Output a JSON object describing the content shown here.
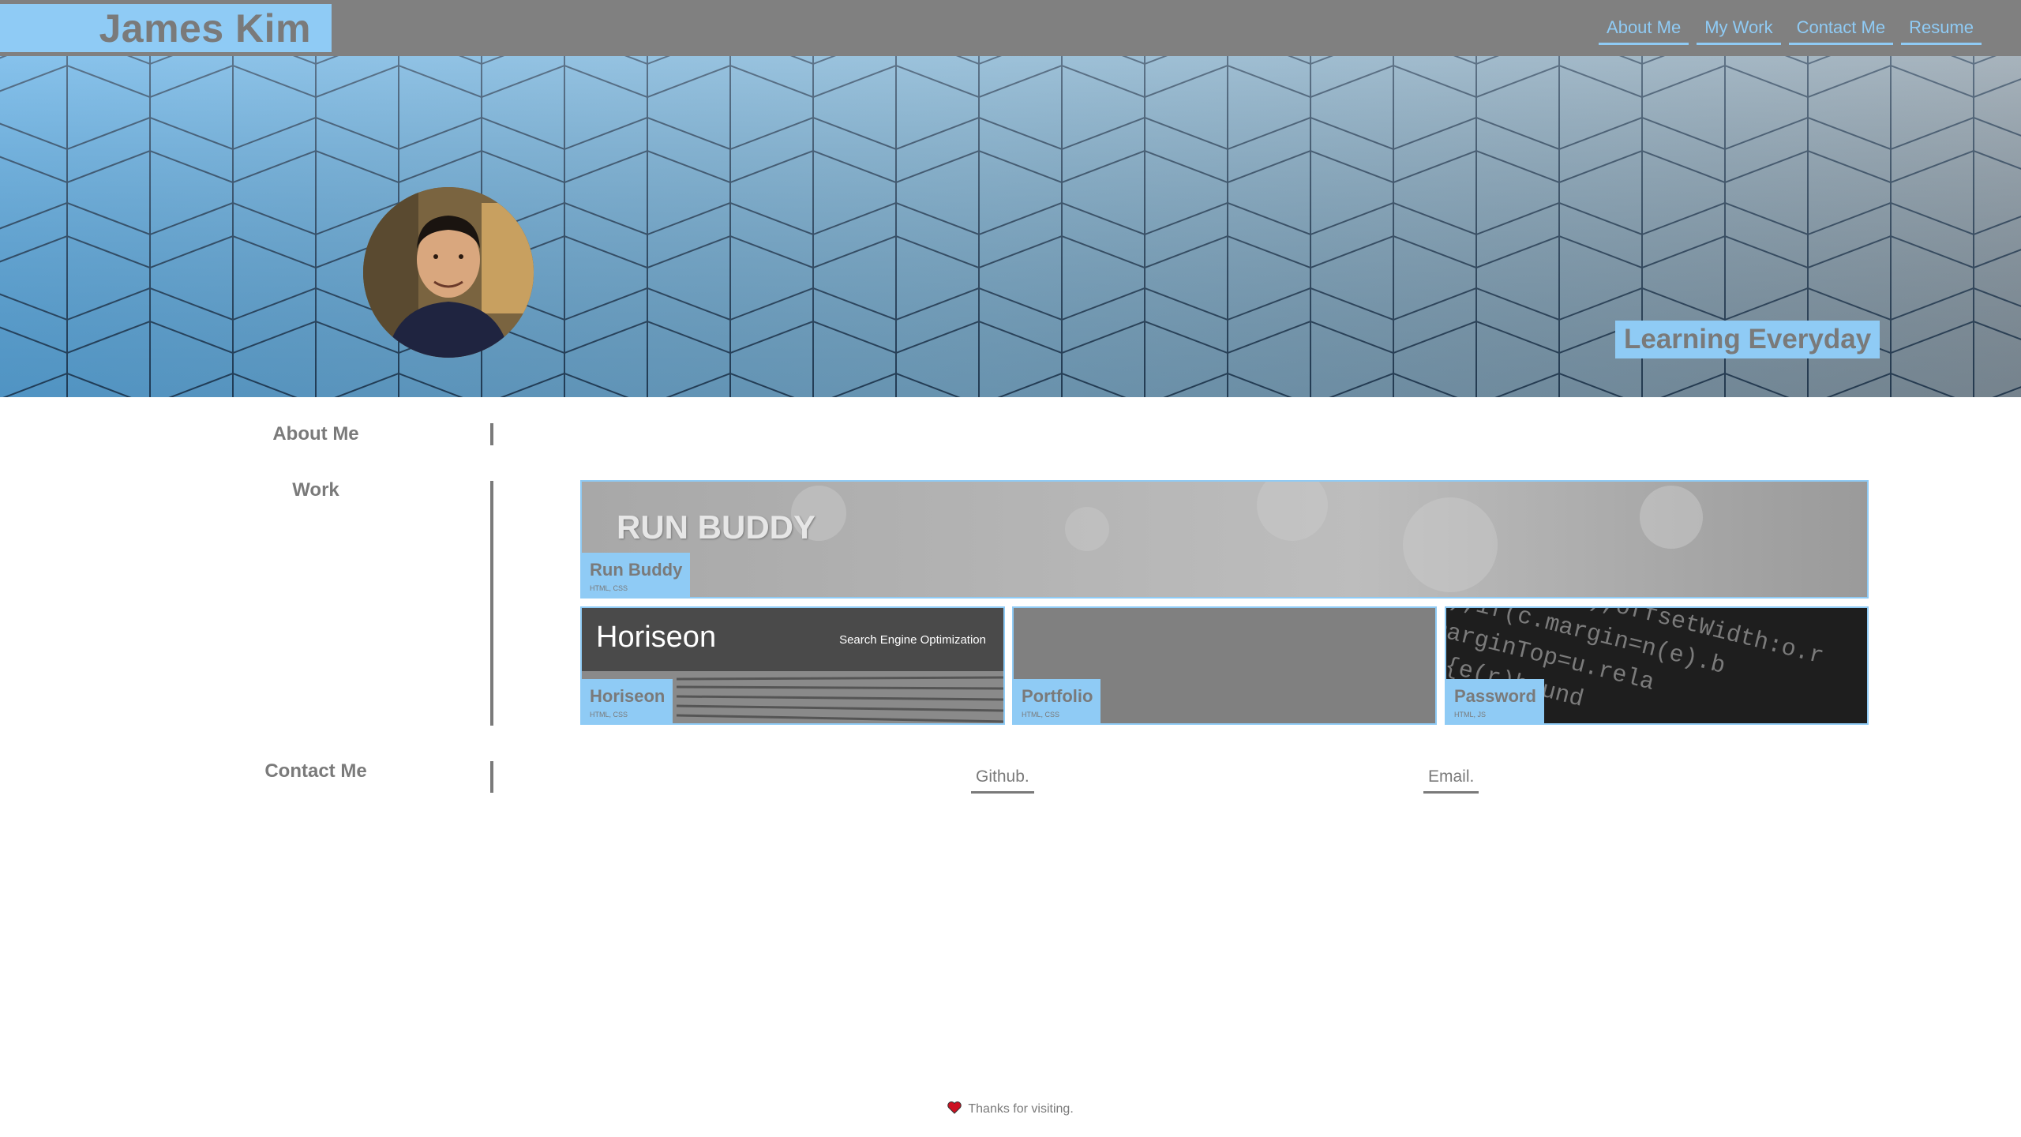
{
  "header": {
    "brand": "James Kim",
    "nav": [
      {
        "label": "About Me"
      },
      {
        "label": "My Work"
      },
      {
        "label": "Contact Me"
      },
      {
        "label": "Resume"
      }
    ]
  },
  "hero": {
    "tagline": "Learning Everyday",
    "avatar_icon": "profile-photo"
  },
  "sections": {
    "about": "About Me",
    "work": "Work",
    "contact": "Contact Me"
  },
  "work": {
    "featured": {
      "name": "Run Buddy",
      "tech": "HTML, CSS",
      "banner": "RUN BUDDY"
    },
    "cards": [
      {
        "name": "Horiseon",
        "tech": "HTML, CSS",
        "banner": "Horiseon",
        "banner_sub": "Search Engine Optimization"
      },
      {
        "name": "Portfolio",
        "tech": "HTML, CSS"
      },
      {
        "name": "Password",
        "tech": "HTML, JS"
      }
    ]
  },
  "contact": {
    "github": "Github.",
    "email": "Email."
  },
  "footer": {
    "text": "Thanks for visiting.",
    "icon": "heart-icon"
  },
  "colors": {
    "accent": "#8fcbf5",
    "header_bg": "#808080",
    "text": "#7a7a7a"
  }
}
